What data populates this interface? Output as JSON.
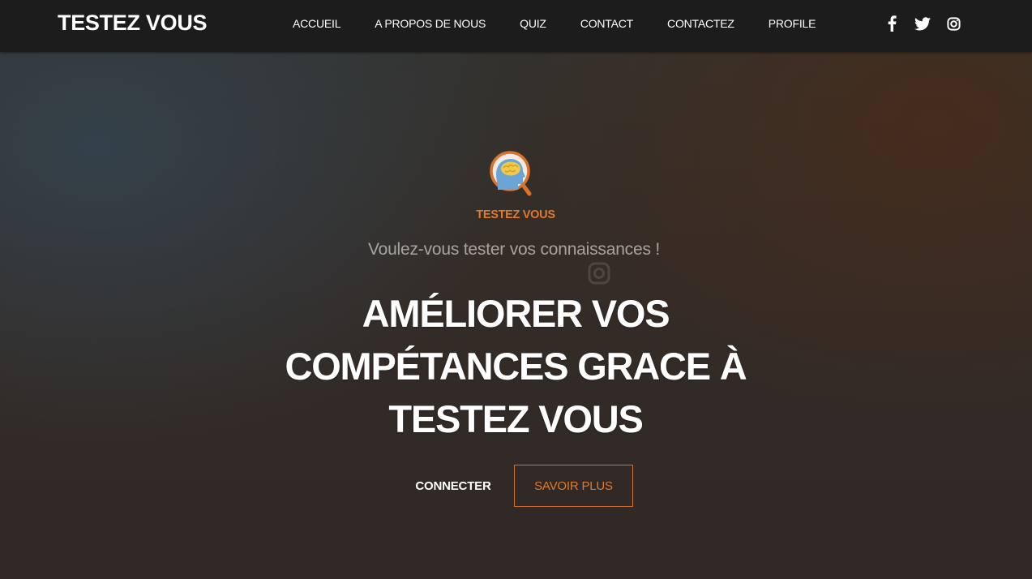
{
  "header": {
    "brand": "TESTEZ VOUS",
    "nav": [
      {
        "label": "ACCUEIL"
      },
      {
        "label": "A PROPOS DE NOUS"
      },
      {
        "label": "QUIZ"
      },
      {
        "label": "CONTACT"
      },
      {
        "label": "CONTACTEZ"
      },
      {
        "label": "PROFILE"
      }
    ],
    "social": [
      {
        "icon": "facebook-icon"
      },
      {
        "icon": "twitter-icon"
      },
      {
        "icon": "instagram-icon"
      }
    ]
  },
  "hero": {
    "logo_text": "TESTEZ VOUS",
    "tagline": "Voulez-vous tester vos connaissances !",
    "headline_lines": [
      "AMÉLIORER VOS",
      "COMPÉTANCES GRACE À",
      "TESTEZ VOUS"
    ],
    "primary_button": "CONNECTER",
    "secondary_button": "SAVOIR PLUS"
  },
  "colors": {
    "accent": "#e07a2d",
    "header_bg": "#1c1c1c",
    "text": "#ffffff"
  }
}
